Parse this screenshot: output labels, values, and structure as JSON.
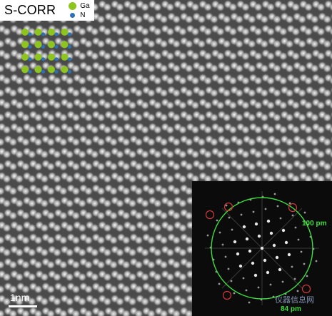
{
  "title": "S-CORR",
  "legend": [
    {
      "symbol": "Ga",
      "color": "#8dc41e"
    },
    {
      "symbol": "N",
      "color": "#2f6fb5"
    }
  ],
  "scale_bar": "1nm",
  "fft": {
    "ring_label_outer": "100 pm",
    "ring_label_inner": "84 pm",
    "ring_color": "#3fdc3f",
    "marker_color": "#d23a3a"
  },
  "watermark": "仪器信息网"
}
